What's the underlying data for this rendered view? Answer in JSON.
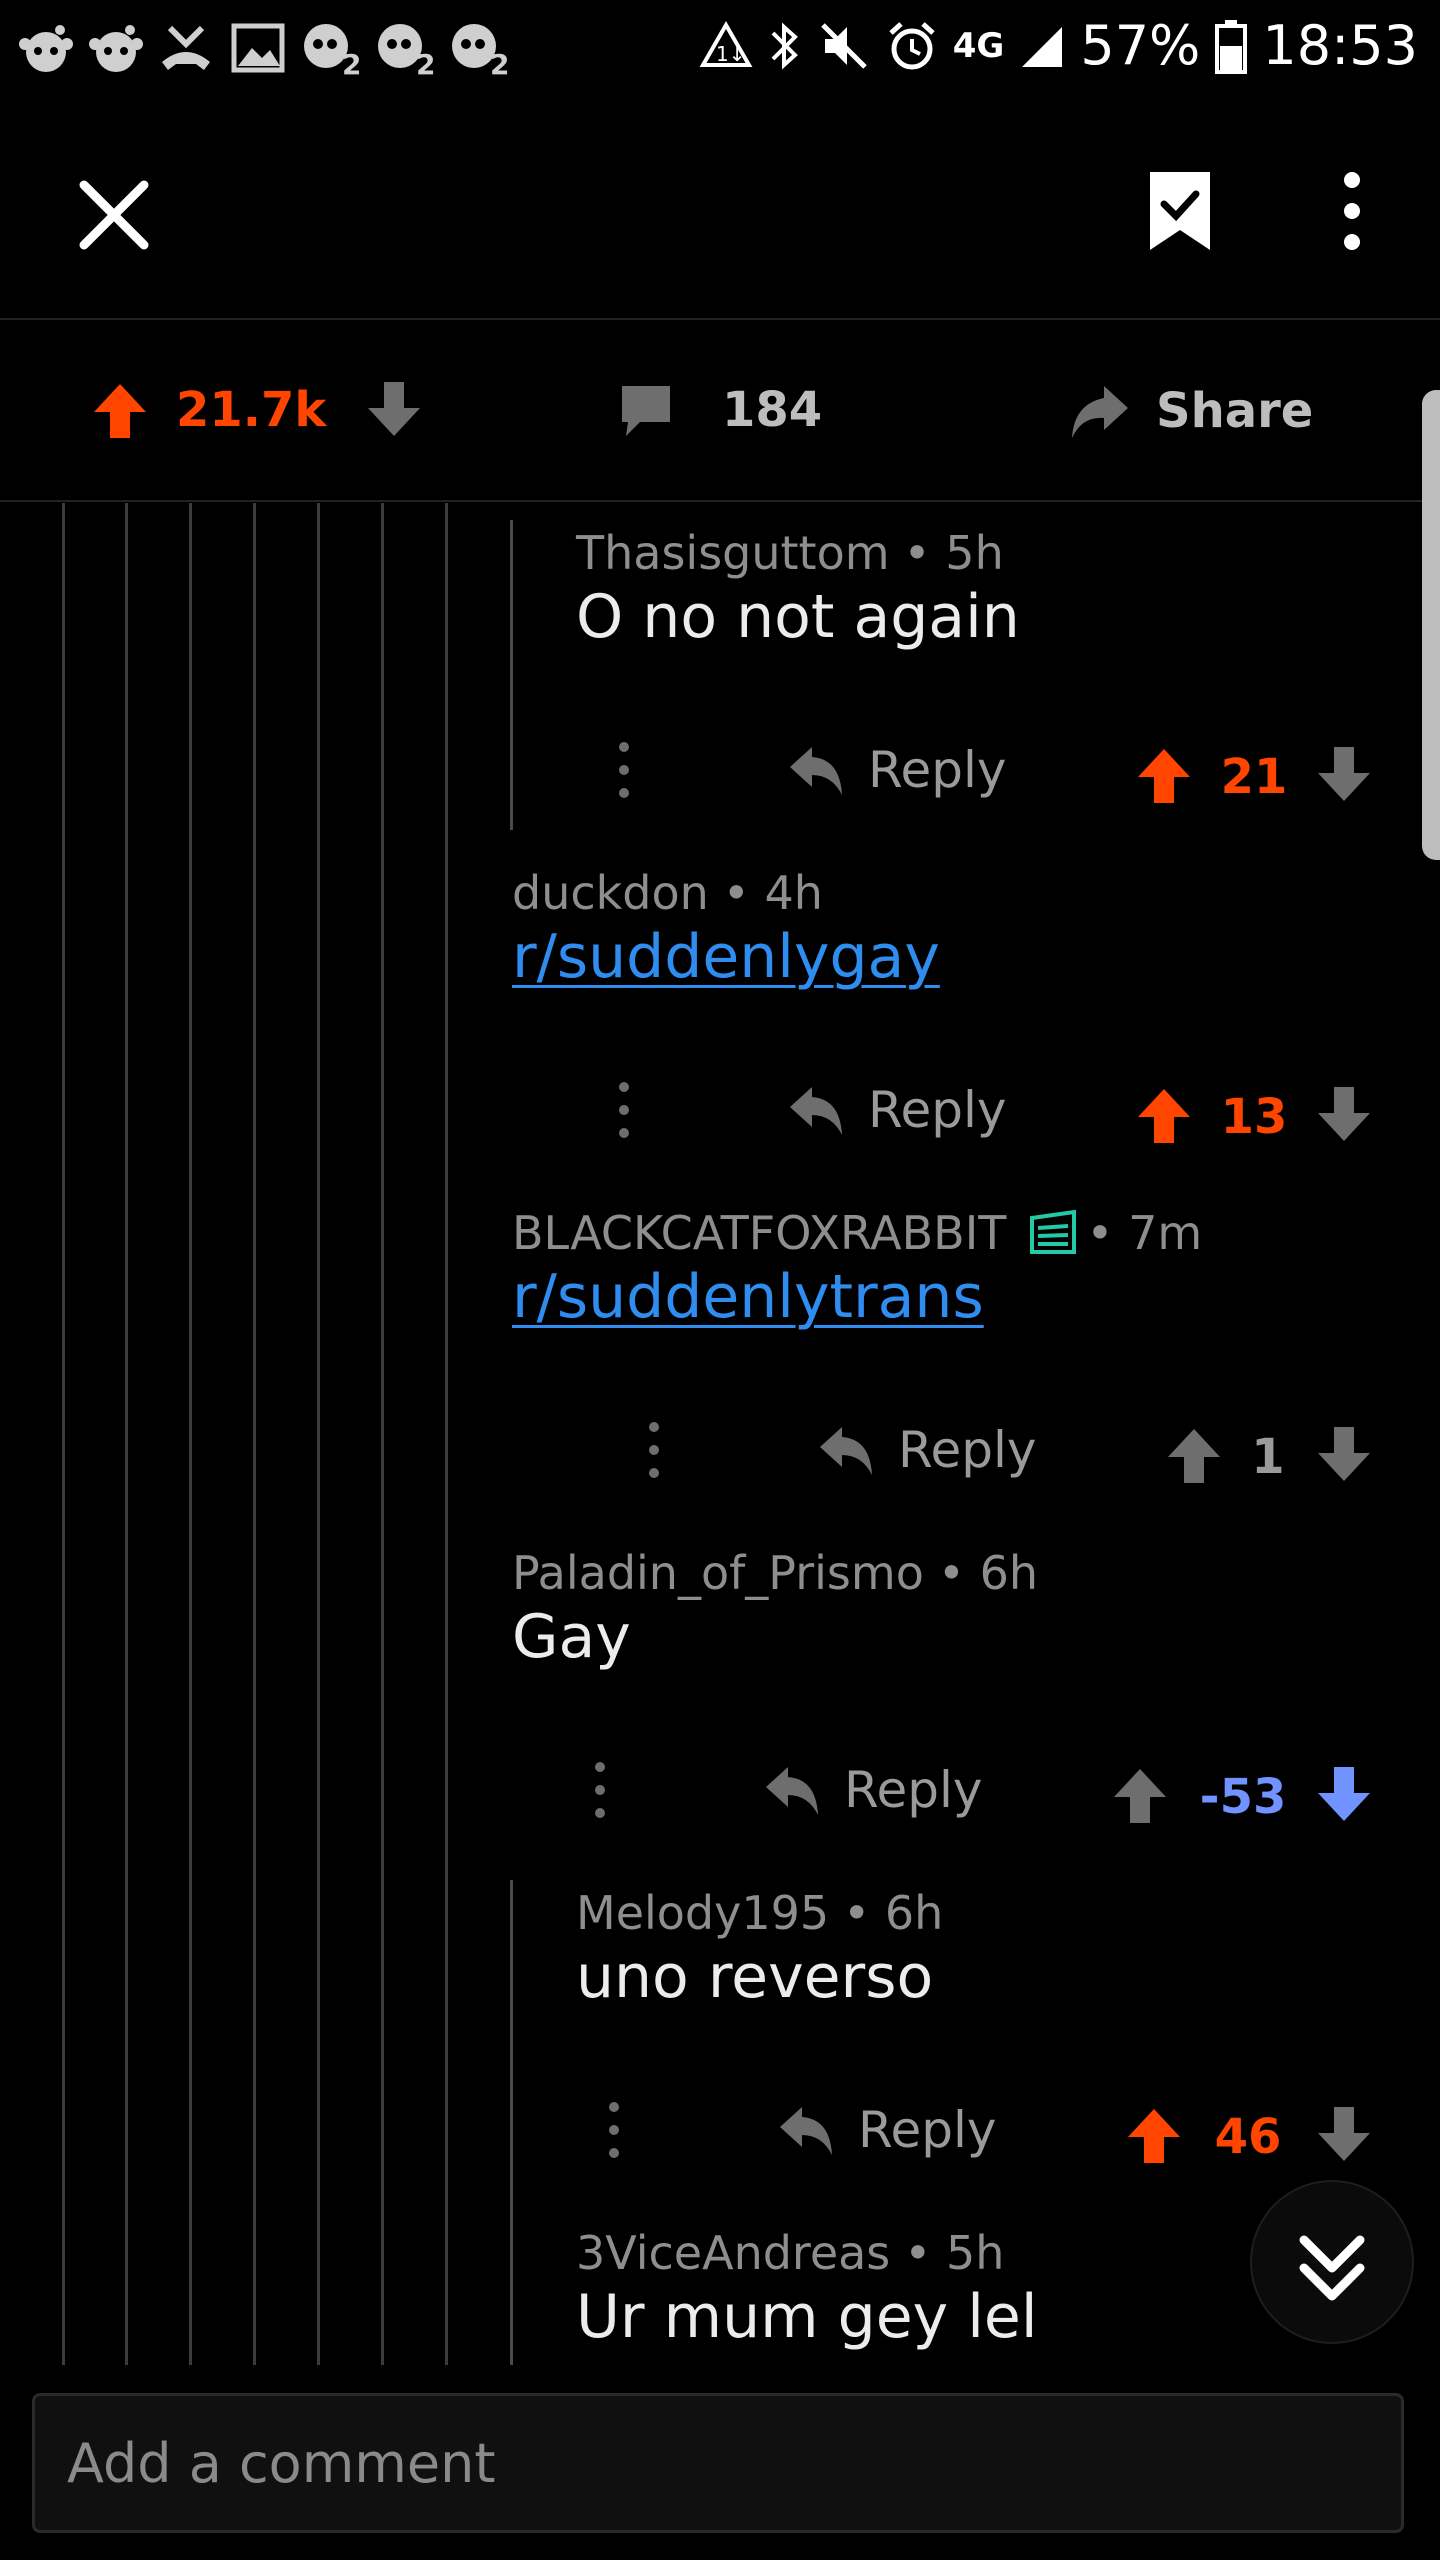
{
  "status_bar": {
    "battery": "57%",
    "time": "18:53",
    "network": "4G",
    "left_icons": [
      "reddit-icon",
      "reddit-icon",
      "missed-call-icon",
      "image-icon",
      "plants-vs-zombies-icon",
      "plants-vs-zombies-icon",
      "plants-vs-zombies-icon"
    ]
  },
  "post_actions": {
    "upvotes": "21.7k",
    "comments": "184",
    "share": "Share"
  },
  "colors": {
    "upvote": "#ff4500",
    "downvote": "#7193ff",
    "link": "#2f8df0",
    "flair": "#24c9a7"
  },
  "comments": [
    {
      "author": "Thasisguttom",
      "time": "• 5h",
      "body": "O no not again",
      "score": "21",
      "vote": "up",
      "reply": "Reply"
    },
    {
      "author": "duckdon",
      "time": "• 4h",
      "body": "r/suddenlygay",
      "score": "13",
      "vote": "up",
      "reply": "Reply"
    },
    {
      "author": "BLACKCATFOXRABBIT",
      "time": "• 7m",
      "body": "r/suddenlytrans",
      "score": "1",
      "vote": "none",
      "reply": "Reply"
    },
    {
      "author": "Paladin_of_Prismo",
      "time": "• 6h",
      "body": "Gay",
      "score": "-53",
      "vote": "down",
      "reply": "Reply"
    },
    {
      "author": "Melody195",
      "time": "• 6h",
      "body": "uno reverso",
      "score": "46",
      "vote": "up",
      "reply": "Reply"
    },
    {
      "author": "3ViceAndreas",
      "time": "• 5h",
      "body": "Ur mum gey lel"
    }
  ],
  "comment_input": {
    "placeholder": "Add a comment"
  }
}
